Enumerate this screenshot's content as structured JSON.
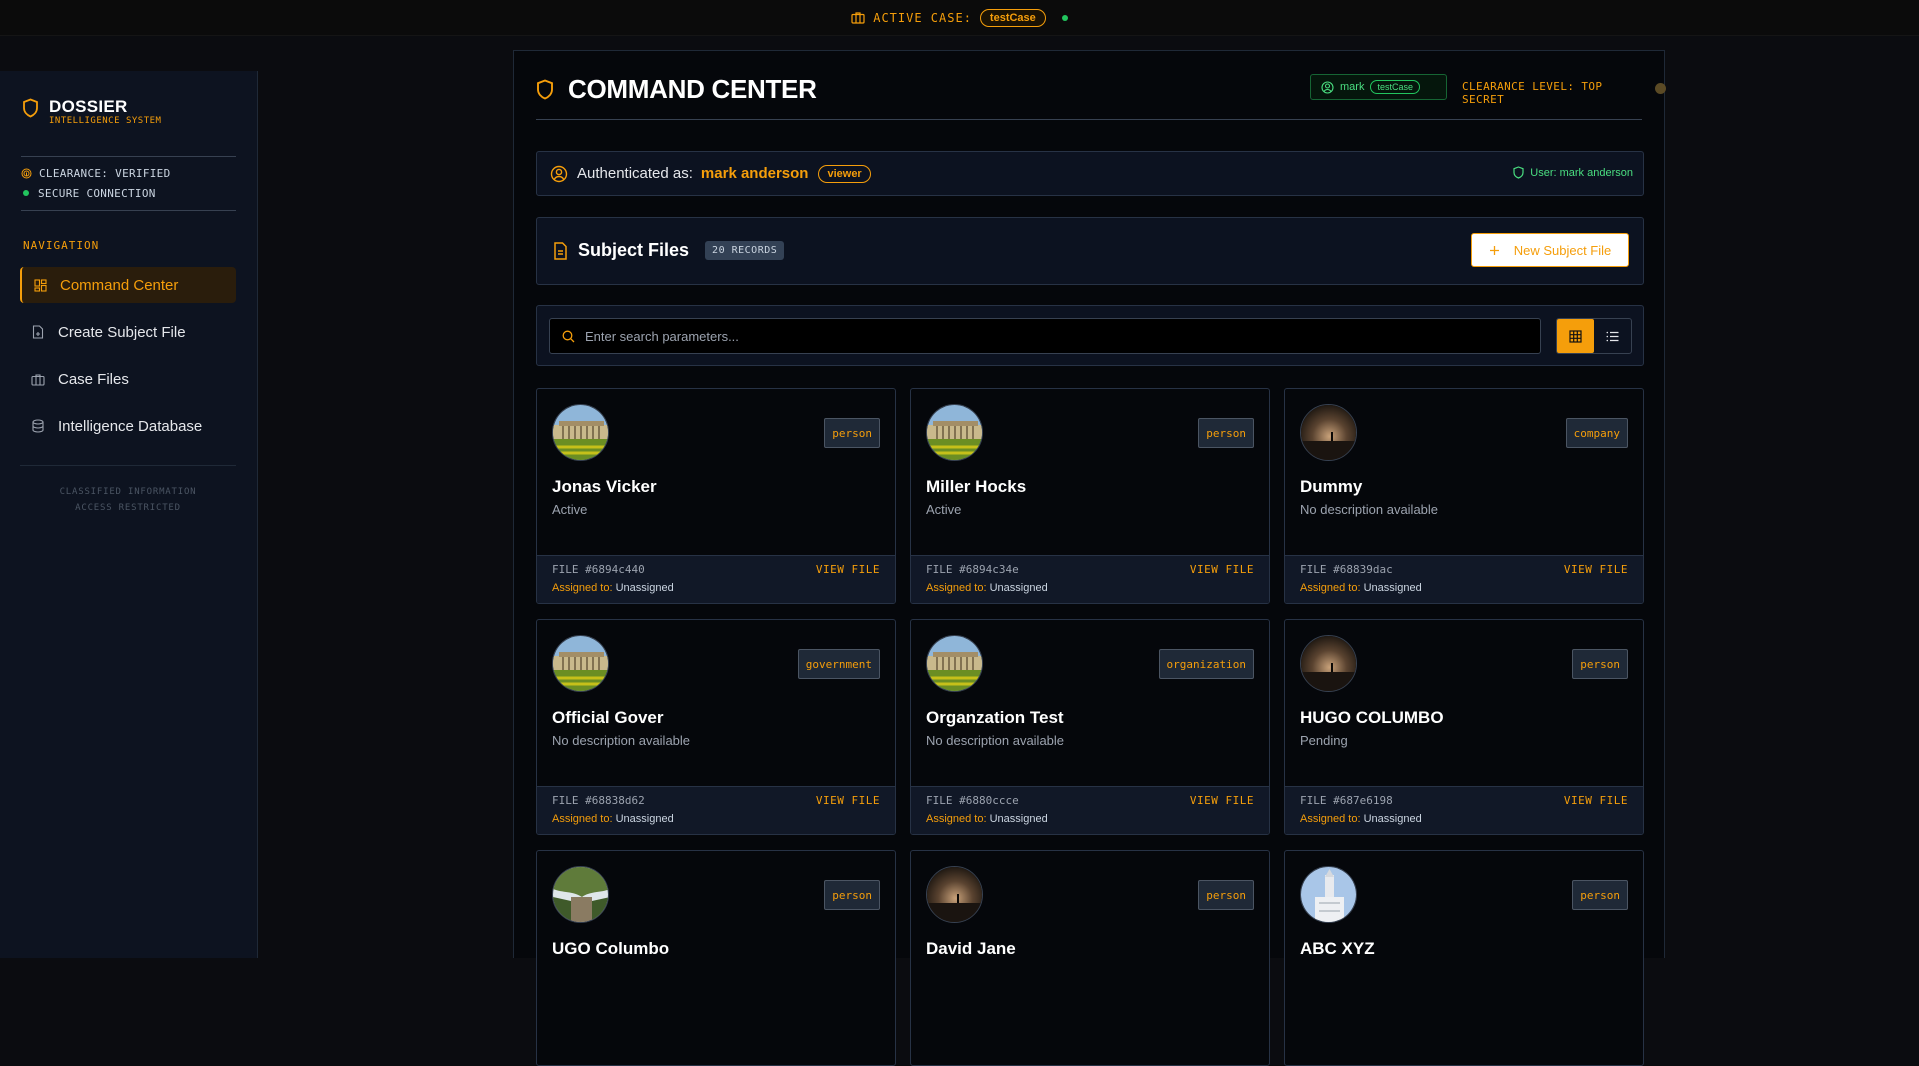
{
  "topbar": {
    "label": "ACTIVE CASE:",
    "case": "testCase"
  },
  "sidebar": {
    "brand_title": "DOSSIER",
    "brand_sub": "INTELLIGENCE SYSTEM",
    "status": [
      "CLEARANCE: VERIFIED",
      "SECURE CONNECTION"
    ],
    "nav_heading": "NAVIGATION",
    "items": [
      {
        "label": "Command Center",
        "icon": "dashboard-icon"
      },
      {
        "label": "Create Subject File",
        "icon": "file-plus-icon"
      },
      {
        "label": "Case Files",
        "icon": "briefcase-icon"
      },
      {
        "label": "Intelligence Database",
        "icon": "database-icon"
      }
    ],
    "footer_line1": "CLASSIFIED INFORMATION",
    "footer_line2": "ACCESS RESTRICTED"
  },
  "header": {
    "title": "COMMAND CENTER",
    "user": "mark",
    "case": "testCase",
    "clearance": "CLEARANCE LEVEL: TOP SECRET"
  },
  "auth": {
    "prefix": "Authenticated as:",
    "name": "mark anderson",
    "role": "viewer",
    "right": "User: mark anderson"
  },
  "files": {
    "title": "Subject Files",
    "records": "20 RECORDS",
    "new_button": "New Subject File"
  },
  "search": {
    "placeholder": "Enter search parameters..."
  },
  "cards": [
    {
      "name": "Jonas Vicker",
      "type": "person",
      "desc": "Active",
      "file": "FILE #6894c440",
      "assigned_label": "Assigned to:",
      "assigned": "Unassigned",
      "view": "VIEW FILE",
      "avatar": "building"
    },
    {
      "name": "Miller Hocks",
      "type": "person",
      "desc": "Active",
      "file": "FILE #6894c34e",
      "assigned_label": "Assigned to:",
      "assigned": "Unassigned",
      "view": "VIEW FILE",
      "avatar": "building"
    },
    {
      "name": "Dummy",
      "type": "company",
      "desc": "No description available",
      "file": "FILE #68839dac",
      "assigned_label": "Assigned to:",
      "assigned": "Unassigned",
      "view": "VIEW FILE",
      "avatar": "sunset"
    },
    {
      "name": "Official Gover",
      "type": "government",
      "desc": "No description available",
      "file": "FILE #68838d62",
      "assigned_label": "Assigned to:",
      "assigned": "Unassigned",
      "view": "VIEW FILE",
      "avatar": "building"
    },
    {
      "name": "Organzation Test",
      "type": "organization",
      "desc": "No description available",
      "file": "FILE #6880ccce",
      "assigned_label": "Assigned to:",
      "assigned": "Unassigned",
      "view": "VIEW FILE",
      "avatar": "building"
    },
    {
      "name": "HUGO COLUMBO",
      "type": "person",
      "desc": "Pending",
      "file": "FILE #687e6198",
      "assigned_label": "Assigned to:",
      "assigned": "Unassigned",
      "view": "VIEW FILE",
      "avatar": "sunset"
    },
    {
      "name": "UGO Columbo",
      "type": "person",
      "desc": "",
      "file": "",
      "assigned_label": "",
      "assigned": "",
      "view": "",
      "avatar": "garden"
    },
    {
      "name": "David Jane",
      "type": "person",
      "desc": "",
      "file": "",
      "assigned_label": "",
      "assigned": "",
      "view": "",
      "avatar": "sunset"
    },
    {
      "name": "ABC XYZ",
      "type": "person",
      "desc": "",
      "file": "",
      "assigned_label": "",
      "assigned": "",
      "view": "",
      "avatar": "tower"
    }
  ]
}
